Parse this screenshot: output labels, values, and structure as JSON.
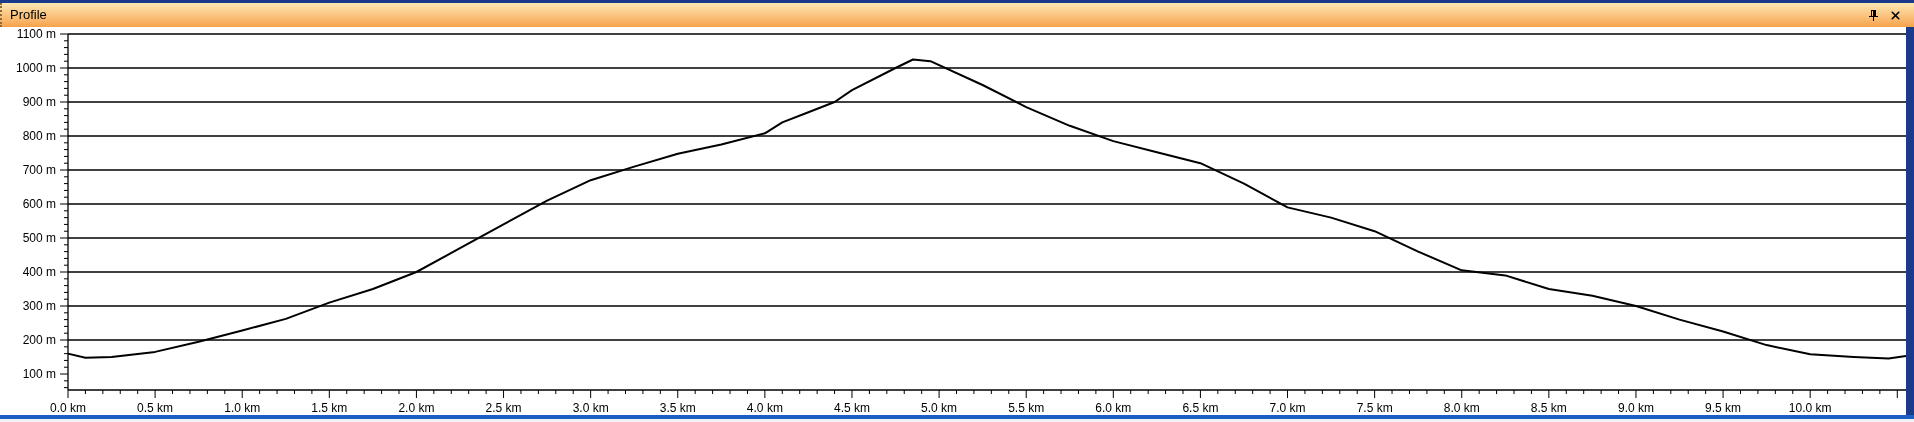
{
  "window": {
    "title": "Profile"
  },
  "chart_data": {
    "type": "line",
    "xlabel": null,
    "ylabel": null,
    "x": [
      0,
      0.1,
      0.25,
      0.5,
      0.75,
      1.0,
      1.25,
      1.5,
      1.75,
      2.0,
      2.25,
      2.5,
      2.75,
      3.0,
      3.25,
      3.5,
      3.75,
      4.0,
      4.1,
      4.25,
      4.4,
      4.5,
      4.75,
      4.85,
      4.95,
      5.25,
      5.5,
      5.75,
      6.0,
      6.25,
      6.5,
      6.75,
      7.0,
      7.25,
      7.5,
      7.75,
      8.0,
      8.25,
      8.5,
      8.75,
      9.0,
      9.25,
      9.5,
      9.75,
      10.0,
      10.25,
      10.45,
      10.55
    ],
    "grid": true,
    "series": [
      {
        "color": "#000000",
        "values": [
          160,
          148,
          150,
          165,
          195,
          228,
          262,
          310,
          350,
          400,
          470,
          540,
          610,
          670,
          710,
          748,
          775,
          808,
          840,
          870,
          900,
          935,
          1000,
          1025,
          1020,
          950,
          885,
          830,
          785,
          752,
          720,
          660,
          590,
          560,
          520,
          460,
          405,
          390,
          350,
          330,
          300,
          260,
          225,
          185,
          158,
          150,
          146,
          153
        ]
      }
    ],
    "xlim": [
      0,
      10.55
    ],
    "ylim": [
      53,
      1100
    ],
    "xticks": [
      {
        "value": 0,
        "label": "0.0 km"
      },
      {
        "value": 0.5,
        "label": "0.5 km"
      },
      {
        "value": 1,
        "label": "1.0 km"
      },
      {
        "value": 1.5,
        "label": "1.5 km"
      },
      {
        "value": 2,
        "label": "2.0 km"
      },
      {
        "value": 2.5,
        "label": "2.5 km"
      },
      {
        "value": 3,
        "label": "3.0 km"
      },
      {
        "value": 3.5,
        "label": "3.5 km"
      },
      {
        "value": 4,
        "label": "4.0 km"
      },
      {
        "value": 4.5,
        "label": "4.5 km"
      },
      {
        "value": 5,
        "label": "5.0 km"
      },
      {
        "value": 5.5,
        "label": "5.5 km"
      },
      {
        "value": 6,
        "label": "6.0 km"
      },
      {
        "value": 6.5,
        "label": "6.5 km"
      },
      {
        "value": 7,
        "label": "7.0 km"
      },
      {
        "value": 7.5,
        "label": "7.5 km"
      },
      {
        "value": 8,
        "label": "8.0 km"
      },
      {
        "value": 8.5,
        "label": "8.5 km"
      },
      {
        "value": 9,
        "label": "9.0 km"
      },
      {
        "value": 9.5,
        "label": "9.5 km"
      },
      {
        "value": 10,
        "label": "10.0 km"
      }
    ],
    "yticks": [
      {
        "value": 100,
        "label": "100 m"
      },
      {
        "value": 200,
        "label": "200 m"
      },
      {
        "value": 300,
        "label": "300 m"
      },
      {
        "value": 400,
        "label": "400 m"
      },
      {
        "value": 500,
        "label": "500 m"
      },
      {
        "value": 600,
        "label": "600 m"
      },
      {
        "value": 700,
        "label": "700 m"
      },
      {
        "value": 800,
        "label": "800 m"
      },
      {
        "value": 900,
        "label": "900 m"
      },
      {
        "value": 1000,
        "label": "1000 m"
      },
      {
        "value": 1100,
        "label": "1100 m"
      }
    ]
  }
}
